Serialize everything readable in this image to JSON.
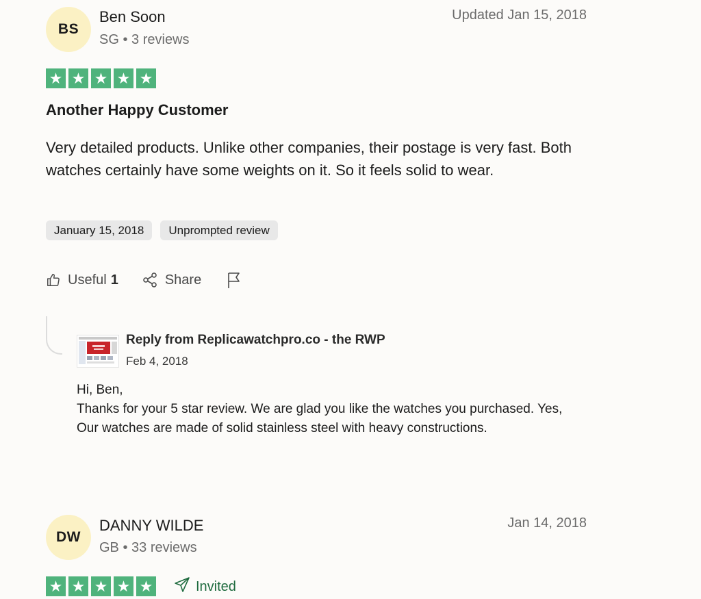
{
  "reviews": [
    {
      "initials": "BS",
      "name": "Ben Soon",
      "country": "SG",
      "review_count": "3 reviews",
      "date_label": "Updated Jan 15, 2018",
      "rating": 5,
      "title": "Another Happy Customer",
      "body": "Very detailed products. Unlike other companies, their postage is very fast. Both watches certainly have some weights on it. So it feels solid to wear.",
      "tags": [
        "January 15, 2018",
        "Unprompted review"
      ],
      "actions": {
        "useful_label": "Useful",
        "useful_count": "1",
        "share_label": "Share"
      },
      "reply": {
        "title": "Reply from Replicawatchpro.co - the RWP",
        "date": "Feb 4, 2018",
        "greeting": "Hi, Ben,",
        "body": "Thanks for your 5 star review. We are glad you like the watches you purchased. Yes, Our watches are made of solid stainless steel with heavy constructions."
      }
    },
    {
      "initials": "DW",
      "name": "DANNY WILDE",
      "country": "GB",
      "review_count": "33 reviews",
      "date_label": "Jan 14, 2018",
      "rating": 5,
      "badge": "Invited"
    }
  ],
  "colors": {
    "star_green": "#4fb37c",
    "avatar_bg": "#fbf1c4",
    "invited_green": "#1f6b3f"
  },
  "icons": {
    "star": "star-icon",
    "useful": "thumbs-up-icon",
    "share": "share-icon",
    "report": "flag-icon",
    "invited": "paper-plane-icon"
  }
}
